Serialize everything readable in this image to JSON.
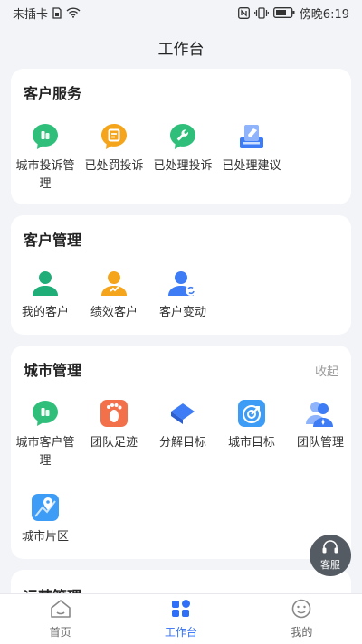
{
  "status_bar": {
    "carrier": "未插卡",
    "time": "傍晚6:19"
  },
  "header": {
    "title": "工作台"
  },
  "sections": [
    {
      "title": "客户服务",
      "items": [
        {
          "label": "城市投诉管理",
          "icon": "chat-doc-icon",
          "color": "#2fbf7a"
        },
        {
          "label": "已处罚投诉",
          "icon": "penalty-chat-icon",
          "color": "#f4a51c"
        },
        {
          "label": "已处理投诉",
          "icon": "wrench-chat-icon",
          "color": "#2fbf7a"
        },
        {
          "label": "已处理建议",
          "icon": "suggestion-icon",
          "color": "#3d7cf5"
        }
      ]
    },
    {
      "title": "客户管理",
      "items": [
        {
          "label": "我的客户",
          "icon": "user-icon",
          "color": "#1fae77"
        },
        {
          "label": "绩效客户",
          "icon": "user-performance-icon",
          "color": "#f4a51c"
        },
        {
          "label": "客户变动",
          "icon": "user-change-icon",
          "color": "#3d7cf5"
        }
      ]
    },
    {
      "title": "城市管理",
      "action": "收起",
      "items": [
        {
          "label": "城市客户管理",
          "icon": "chat-doc-icon",
          "color": "#2fbf7a"
        },
        {
          "label": "团队足迹",
          "icon": "footprint-icon",
          "color": "#f2714a"
        },
        {
          "label": "分解目标",
          "icon": "layers-icon",
          "color": "#3d7cf5"
        },
        {
          "label": "城市目标",
          "icon": "target-icon",
          "color": "#3d9cf5"
        },
        {
          "label": "团队管理",
          "icon": "team-icon",
          "color": "#3d7cf5"
        },
        {
          "label": "城市片区",
          "icon": "map-pin-icon",
          "color": "#3d9cf5"
        }
      ]
    },
    {
      "title": "运营管理"
    }
  ],
  "float_button": {
    "label": "客服",
    "icon": "headset-icon"
  },
  "tabs": [
    {
      "label": "首页",
      "icon": "home-icon"
    },
    {
      "label": "工作台",
      "icon": "workbench-icon",
      "active": true
    },
    {
      "label": "我的",
      "icon": "profile-icon"
    }
  ],
  "colors": {
    "accent": "#2f6ef6",
    "background": "#f2f4f8",
    "float_button": "#555b63"
  }
}
